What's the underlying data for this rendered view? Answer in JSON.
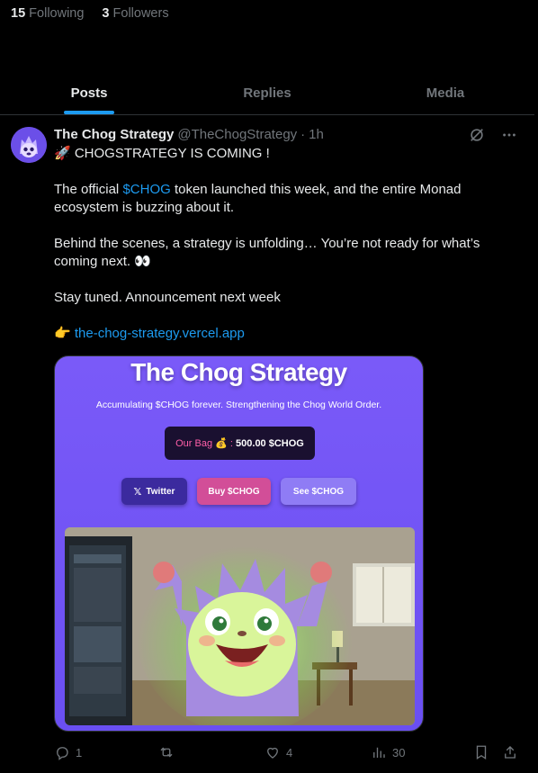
{
  "profile": {
    "following_count": "15",
    "following_label": "Following",
    "followers_count": "3",
    "followers_label": "Followers"
  },
  "tabs": [
    {
      "label": "Posts",
      "active": true
    },
    {
      "label": "Replies",
      "active": false
    },
    {
      "label": "Media",
      "active": false
    }
  ],
  "post": {
    "author_name": "The Chog Strategy",
    "author_handle": "@TheChogStrategy",
    "separator": "·",
    "time": "1h",
    "line1": "🚀 CHOGSTRATEGY IS COMING !",
    "line2_pre": "The official ",
    "line2_link": "$CHOG",
    "line2_post": " token launched this week, and the entire Monad ecosystem is buzzing about it.",
    "line3": "Behind the scenes, a strategy is unfolding… You’re not ready for what’s coming next. 👀",
    "line4": "Stay tuned. Announcement next week",
    "line5_emoji": "👉",
    "line5_link": "the-chog-strategy.vercel.app",
    "card": {
      "title": "The Chog Strategy",
      "subtitle": "Accumulating $CHOG forever. Strengthening the Chog World Order.",
      "bag_label": "Our Bag 💰 :",
      "bag_value": "500.00 $CHOG",
      "btn_twitter": "Twitter",
      "btn_buy": "Buy $CHOG",
      "btn_see": "See $CHOG"
    },
    "actions": {
      "replies": "1",
      "reposts": "",
      "likes": "4",
      "views": "30"
    }
  },
  "colors": {
    "accent": "#1d9bf0",
    "background": "#000000",
    "muted": "#71767b",
    "card_purple": "#7a5af8"
  }
}
